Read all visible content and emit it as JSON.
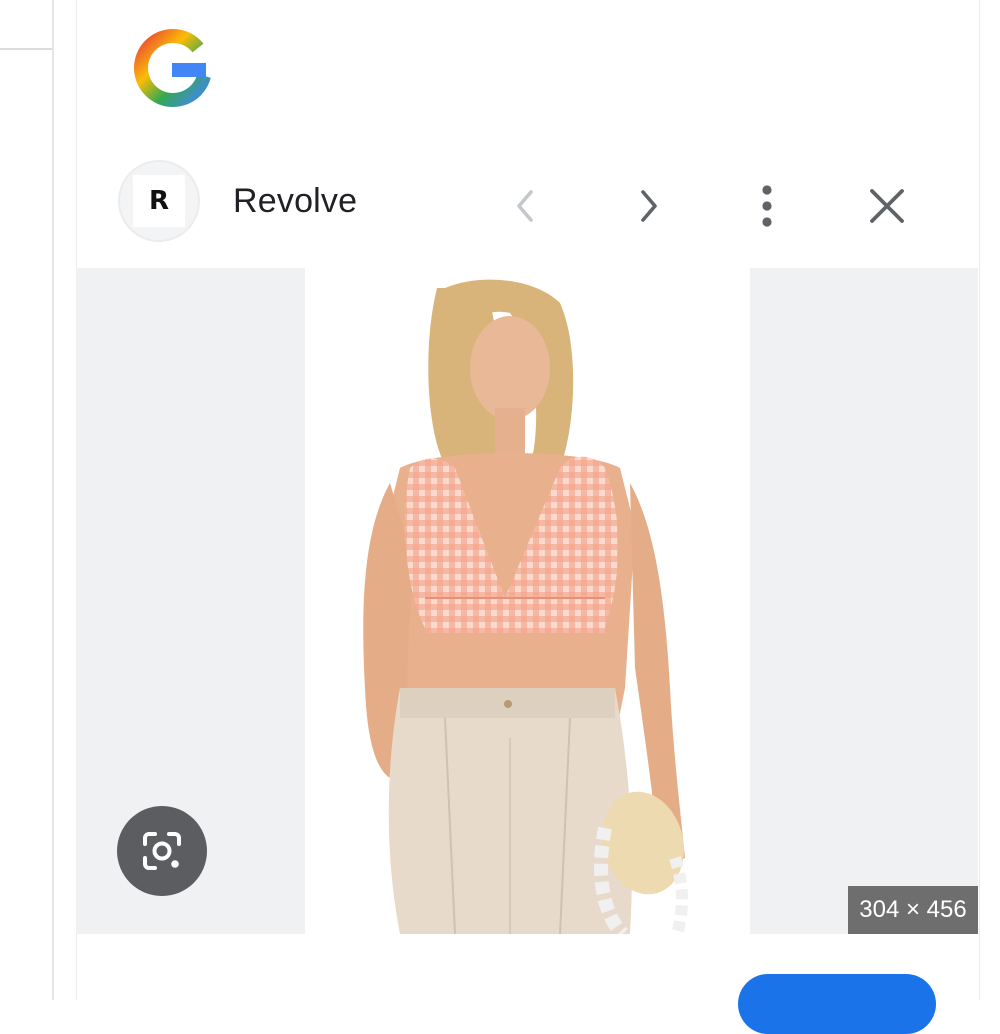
{
  "site": {
    "avatar_letter": "R",
    "name": "Revolve"
  },
  "image": {
    "dimensions": "304 × 456"
  },
  "icons": {
    "logo": "google-g-logo",
    "prev": "chevron-left-icon",
    "next": "chevron-right-icon",
    "more": "more-vertical-icon",
    "close": "close-icon",
    "lens": "google-lens-icon"
  },
  "colors": {
    "accent": "#1a73e8",
    "panel_gray": "#eff1f3",
    "badge": "#6e6e6e",
    "lens_button": "#5b5d60"
  }
}
